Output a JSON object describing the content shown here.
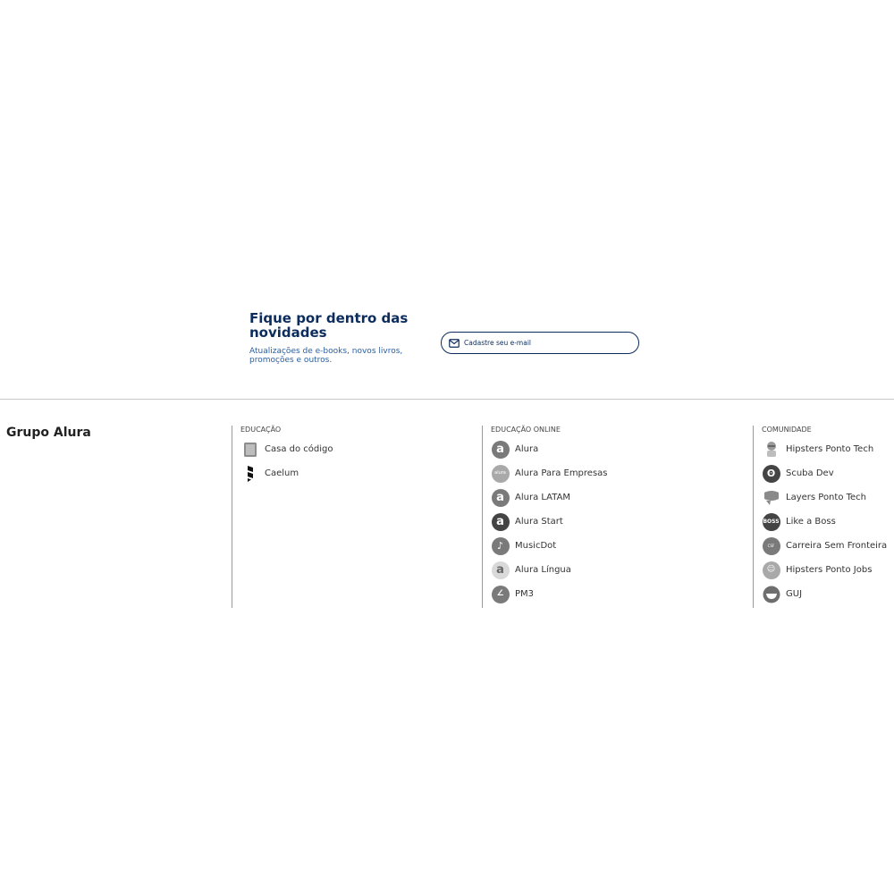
{
  "newsletter": {
    "title": "Fique por dentro das novidades",
    "subtitle": "Atualizações de e-books, novos livros, promoções e outros.",
    "email_placeholder": "Cadastre seu e-mail"
  },
  "footer": {
    "brand": "Grupo Alura",
    "columns": {
      "educacao": {
        "title": "EDUCAÇÃO",
        "items": [
          {
            "label": "Casa do código",
            "icon": "casa-do-codigo-icon"
          },
          {
            "label": "Caelum",
            "icon": "caelum-icon"
          }
        ]
      },
      "educacao_online": {
        "title": "EDUCAÇÃO ONLINE",
        "items": [
          {
            "label": "Alura",
            "icon": "alura-icon"
          },
          {
            "label": "Alura Para Empresas",
            "icon": "alura-empresas-icon"
          },
          {
            "label": "Alura LATAM",
            "icon": "alura-latam-icon"
          },
          {
            "label": "Alura Start",
            "icon": "alura-start-icon"
          },
          {
            "label": "MusicDot",
            "icon": "musicdot-icon"
          },
          {
            "label": "Alura Língua",
            "icon": "alura-lingua-icon"
          },
          {
            "label": "PM3",
            "icon": "pm3-icon"
          }
        ]
      },
      "comunidade": {
        "title": "COMUNIDADE",
        "items": [
          {
            "label": "Hipsters Ponto Tech",
            "icon": "hipsters-ponto-tech-icon"
          },
          {
            "label": "Scuba Dev",
            "icon": "scuba-dev-icon"
          },
          {
            "label": "Layers Ponto Tech",
            "icon": "layers-ponto-tech-icon"
          },
          {
            "label": "Like a Boss",
            "icon": "like-a-boss-icon"
          },
          {
            "label": "Carreira Sem Fronteira",
            "icon": "carreira-sem-fronteira-icon"
          },
          {
            "label": "Hipsters Ponto Jobs",
            "icon": "hipsters-ponto-jobs-icon"
          },
          {
            "label": "GUJ",
            "icon": "guj-icon"
          }
        ]
      }
    }
  },
  "colors": {
    "navy": "#0b2c5c",
    "link_blue": "#2a5fa0",
    "icon_gray": "#7a7a7a",
    "divider": "#c9c9c9"
  }
}
